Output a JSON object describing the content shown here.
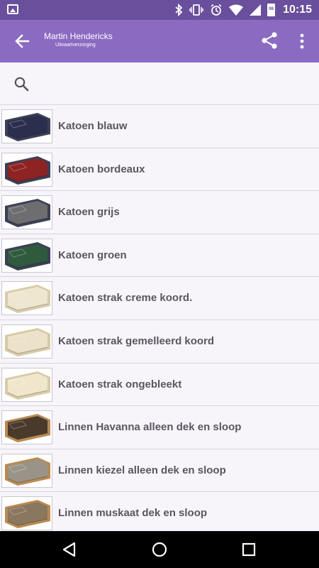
{
  "status_bar": {
    "time": "10:15",
    "icons": [
      "gallery-icon",
      "bluetooth-icon",
      "vibrate-icon",
      "alarm-icon",
      "wifi-icon",
      "signal-icon",
      "battery-icon"
    ],
    "battery_level_label": "98"
  },
  "toolbar": {
    "title": "Martin Hendericks",
    "subtitle": "Uitvaartverzorging",
    "back_icon": "arrow-back-icon",
    "share_icon": "share-icon",
    "more_icon": "more-vert-icon"
  },
  "search": {
    "placeholder": "",
    "icon": "search-icon"
  },
  "items": [
    {
      "label": "Katoen blauw",
      "fabric_color": "#2a2f4e",
      "edge_color": "#3c3f55"
    },
    {
      "label": "Katoen bordeaux",
      "fabric_color": "#8e2323",
      "edge_color": "#3c3f55"
    },
    {
      "label": "Katoen grijs",
      "fabric_color": "#6e6e70",
      "edge_color": "#3c3f55"
    },
    {
      "label": "Katoen groen",
      "fabric_color": "#2f5a3e",
      "edge_color": "#3c3f55"
    },
    {
      "label": "Katoen strak creme koord.",
      "fabric_color": "#efe6cf",
      "edge_color": "#d8ccad"
    },
    {
      "label": "Katoen strak gemelleerd koord",
      "fabric_color": "#ece2c9",
      "edge_color": "#d6c9a6"
    },
    {
      "label": "Katoen strak ongebleekt",
      "fabric_color": "#f0e6cc",
      "edge_color": "#d8cba8"
    },
    {
      "label": "Linnen Havanna alleen dek en sloop",
      "fabric_color": "#4a3a2c",
      "edge_color": "#b98a52"
    },
    {
      "label": "Linnen kiezel alleen dek en sloop",
      "fabric_color": "#9a9488",
      "edge_color": "#b98a52"
    },
    {
      "label": "Linnen muskaat dek en sloop",
      "fabric_color": "#8a7760",
      "edge_color": "#b98a52"
    }
  ],
  "nav_bar": {
    "icons": [
      "back-triangle-icon",
      "home-circle-icon",
      "recents-square-icon"
    ]
  }
}
